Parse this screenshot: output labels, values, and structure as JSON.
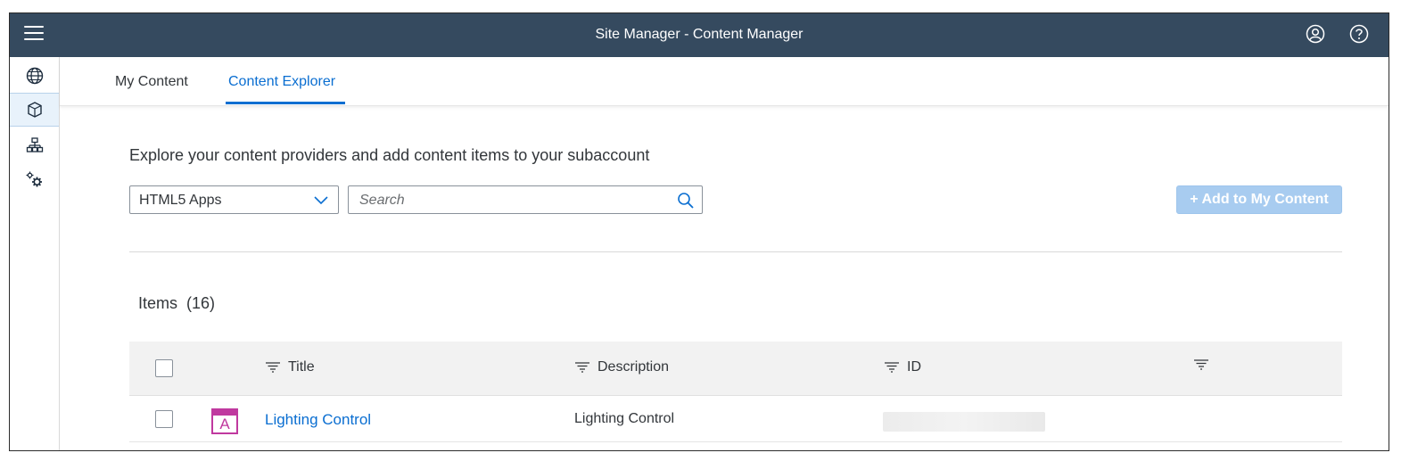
{
  "shell": {
    "title": "Site Manager - Content Manager",
    "menu_icon": "hamburger-menu-icon",
    "profile_icon": "user-profile-icon",
    "help_icon": "help-icon"
  },
  "sidenav": {
    "items": [
      {
        "icon": "globe-icon",
        "active": false
      },
      {
        "icon": "content-cube-icon",
        "active": true
      },
      {
        "icon": "org-hierarchy-icon",
        "active": false
      },
      {
        "icon": "settings-gears-icon",
        "active": false
      }
    ]
  },
  "tabs": [
    {
      "label": "My Content",
      "active": false
    },
    {
      "label": "Content Explorer",
      "active": true
    }
  ],
  "intro_text": "Explore your content providers and add content items to your subaccount",
  "provider_select": {
    "value": "HTML5 Apps"
  },
  "search": {
    "placeholder": "Search",
    "value": ""
  },
  "add_button": {
    "label": "+ Add to My Content",
    "enabled": false
  },
  "items": {
    "title": "Items",
    "count": "(16)"
  },
  "table": {
    "columns": [
      {
        "label": "Title"
      },
      {
        "label": "Description"
      },
      {
        "label": "ID"
      },
      {
        "label": ""
      }
    ],
    "rows": [
      {
        "icon_letter": "A",
        "title": "Lighting Control",
        "description": "Lighting Control",
        "id": ""
      }
    ]
  },
  "colors": {
    "shellbar": "#354a5f",
    "accent": "#0a6ed1",
    "app_icon": "#c0399f",
    "disabled_button": "#a8ccf0"
  }
}
